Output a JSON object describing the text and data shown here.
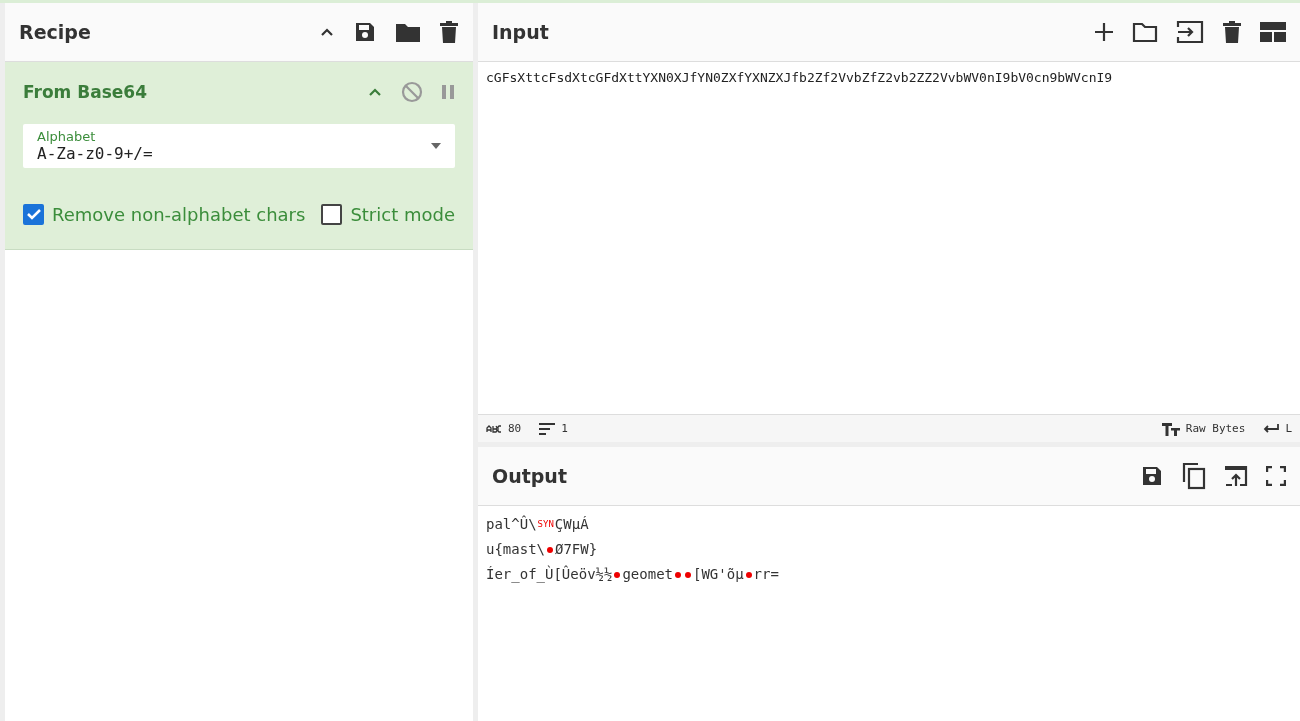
{
  "recipe": {
    "title": "Recipe",
    "operations": [
      {
        "name": "From Base64",
        "expanded": true,
        "disabled": false,
        "paused": false,
        "alphabet": {
          "label": "Alphabet",
          "value": "A-Za-z0-9+/="
        },
        "options": [
          {
            "label": "Remove non-alphabet chars",
            "checked": true
          },
          {
            "label": "Strict mode",
            "checked": false
          }
        ]
      }
    ]
  },
  "input": {
    "title": "Input",
    "text": "cGFsXttcFsdXtcGFdXttYXN0XJfYN0ZXfYXNZXJfb2Zf2VvbZfZ2vb2ZZ2VvbWV0nI9bV0cn9bWVcnI9",
    "status": {
      "length": "80",
      "lines": "1",
      "encoding": "Raw Bytes",
      "eol": "L"
    }
  },
  "output": {
    "title": "Output",
    "lines": [
      [
        {
          "kind": "text",
          "text": "pal^Û\\"
        },
        {
          "kind": "control_label",
          "text": "SYN"
        },
        {
          "kind": "text",
          "text": "ÇWµÁ"
        }
      ],
      [
        {
          "kind": "text",
          "text": "u{mast\\"
        },
        {
          "kind": "control_dot"
        },
        {
          "kind": "text",
          "text": "Ø7FW}"
        }
      ],
      [
        {
          "kind": "text",
          "text": "Íer_of_Ù[Ûeöv½½"
        },
        {
          "kind": "control_dot"
        },
        {
          "kind": "text",
          "text": "geomet"
        },
        {
          "kind": "control_dot"
        },
        {
          "kind": "control_dot"
        },
        {
          "kind": "text",
          "text": "[WG'õµ"
        },
        {
          "kind": "control_dot"
        },
        {
          "kind": "text",
          "text": "rr="
        }
      ]
    ]
  }
}
